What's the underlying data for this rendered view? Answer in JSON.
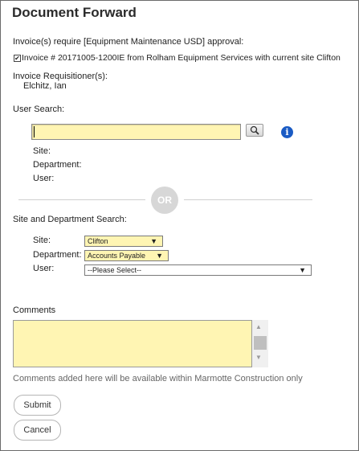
{
  "dialog": {
    "title": "Document Forward",
    "approval_heading": "Invoice(s) require [Equipment Maintenance USD] approval:",
    "invoice_line": "Invoice # 20171005-1200IE from Rolham Equipment Services with current site Clifton",
    "invoice_checked": true,
    "requisitioner_label": "Invoice Requisitioner(s):",
    "requisitioner_name": "Elchitz, Ian"
  },
  "user_search": {
    "heading": "User Search:",
    "input_value": "",
    "search_icon": "magnifier-icon",
    "info_icon": "info-icon",
    "info_symbol": "i",
    "site_label": "Site:",
    "department_label": "Department:",
    "user_label": "User:"
  },
  "separator": {
    "text": "OR"
  },
  "site_dept_search": {
    "heading": "Site and Department Search:",
    "site_label": "Site:",
    "site_value": "Clifton",
    "department_label": "Department:",
    "department_value": "Accounts Payable",
    "user_label": "User:",
    "user_value": "--Please Select--"
  },
  "comments": {
    "label": "Comments",
    "value": "",
    "note": "Comments added here will be available within Marmotte Construction only"
  },
  "buttons": {
    "submit": "Submit",
    "cancel": "Cancel"
  },
  "colors": {
    "input_fill": "#fff5b3",
    "info_blue": "#1a5bc4",
    "or_circle": "#d7d7d7"
  }
}
